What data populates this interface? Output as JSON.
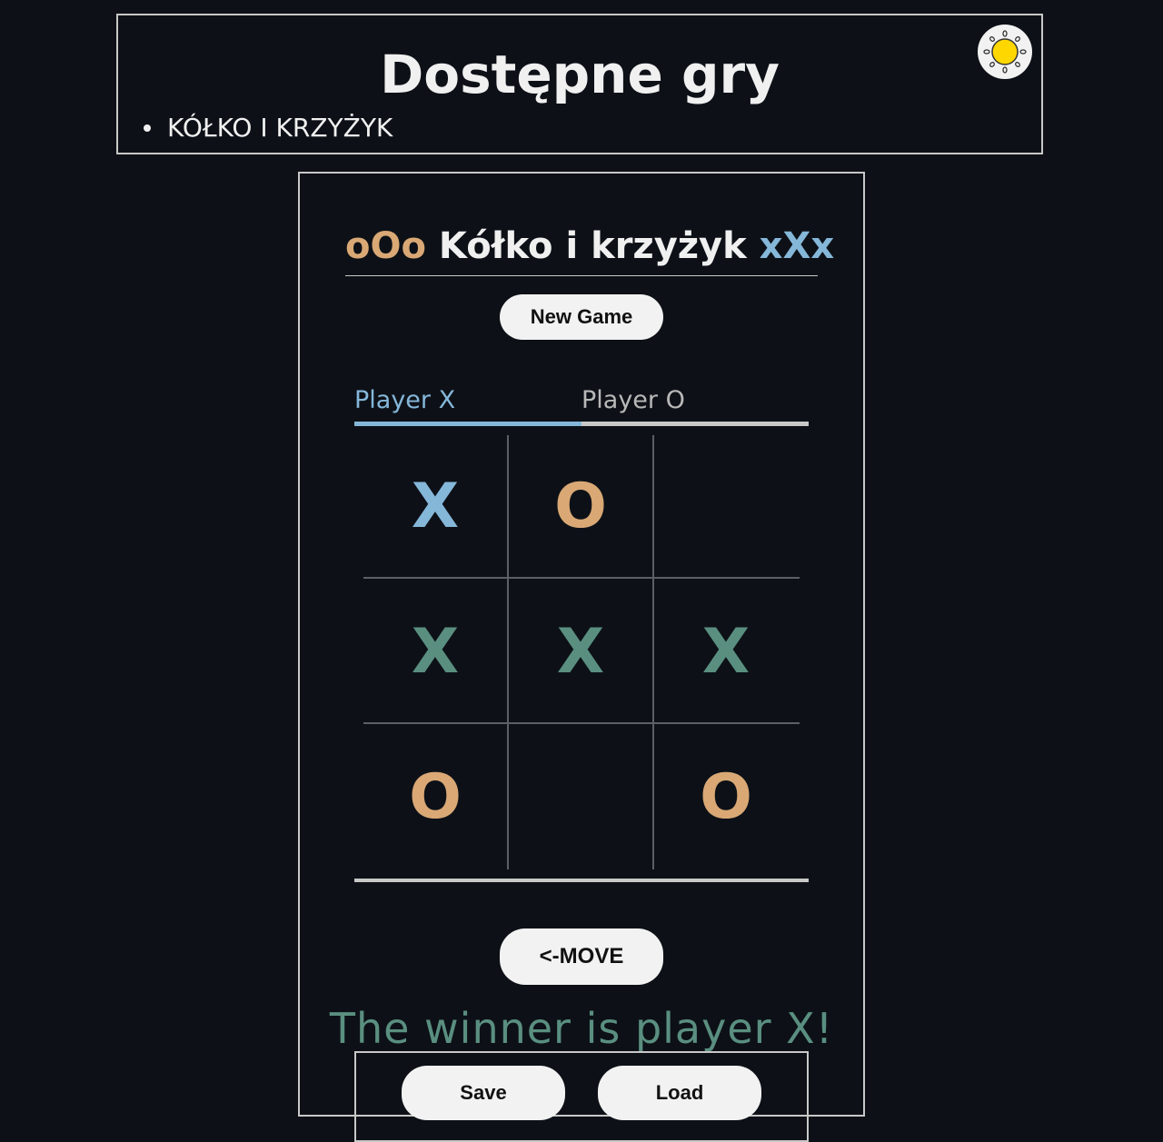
{
  "header": {
    "title": "Dostępne gry",
    "games": [
      "KÓŁKO I KRZYŻYK"
    ]
  },
  "theme_toggle": {
    "icon": "sun-icon",
    "color": "#ffd700"
  },
  "game": {
    "title_left": "oOo",
    "title_main": "Kółko i krzyżyk",
    "title_right": "xXx",
    "new_game_label": "New Game",
    "tabs": [
      {
        "label": "Player X",
        "active": true
      },
      {
        "label": "Player O",
        "active": false
      }
    ],
    "board": [
      [
        "X",
        "O",
        ""
      ],
      [
        "X",
        "X",
        "X"
      ],
      [
        "O",
        "",
        "O"
      ]
    ],
    "winning_line": "row-2",
    "move_label": "<-MOVE",
    "winner_text": "The winner is player X!",
    "save_label": "Save",
    "load_label": "Load"
  },
  "colors": {
    "background": "#0d1117",
    "x": "#85b7d9",
    "o": "#d9a875",
    "win": "#5a8f80"
  }
}
